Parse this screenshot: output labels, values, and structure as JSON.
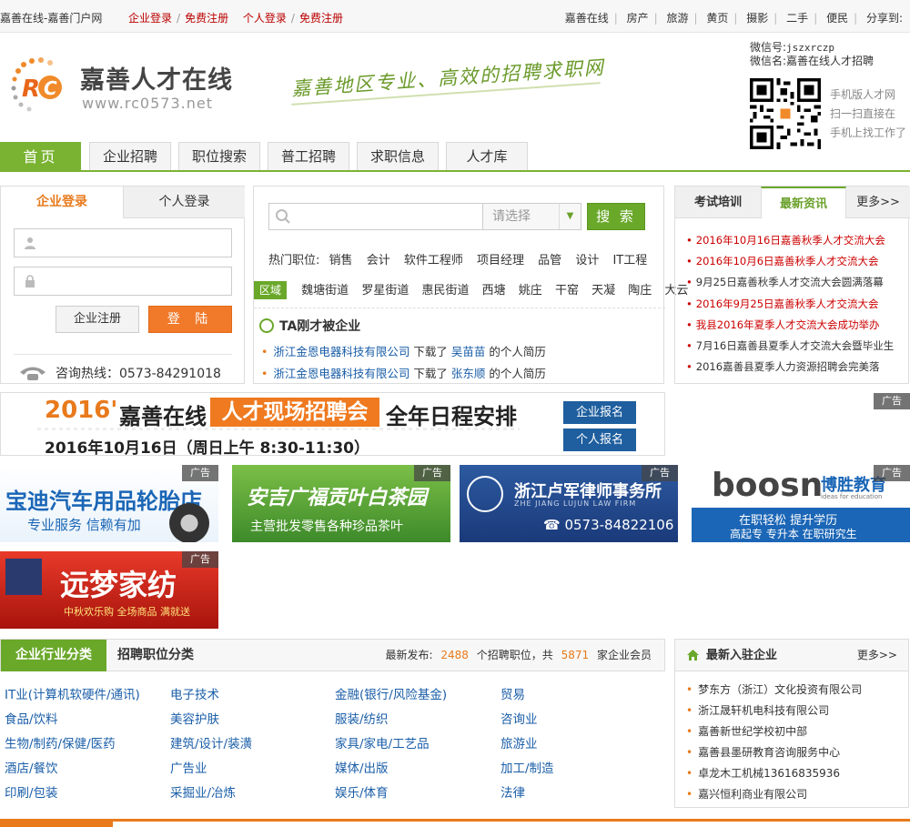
{
  "topbar": {
    "site_name": "嘉善在线-嘉善门户网",
    "company_login": "企业登录",
    "free_register": "免费注册",
    "personal_login": "个人登录",
    "free_register2": "免费注册",
    "nav": [
      "嘉善在线",
      "房产",
      "旅游",
      "黄页",
      "摄影",
      "二手",
      "便民"
    ],
    "share": "分享到:"
  },
  "header": {
    "logo_title": "嘉善人才在线",
    "logo_url": "www.rc0573.net",
    "slogan": "嘉善地区专业、高效的招聘求职网",
    "wechat_id_label": "微信号:",
    "wechat_id": "jszxrczp",
    "wechat_name": "微信名:嘉善在线人才招聘",
    "qr_text": [
      "手机版人才网",
      "扫一扫直接在",
      "手机上找工作了"
    ]
  },
  "mainnav": [
    "首页",
    "企业招聘",
    "职位搜索",
    "普工招聘",
    "求职信息",
    "人才库"
  ],
  "login": {
    "tab_company": "企业登录",
    "tab_personal": "个人登录",
    "username_placeholder": "",
    "password_placeholder": "",
    "register_btn": "企业注册",
    "login_btn": "登 陆",
    "hotline": "咨询热线：0573-84291018"
  },
  "search": {
    "placeholder": "",
    "select_label": "请选择",
    "button": "搜 索",
    "hot_label": "热门职位:",
    "hot_jobs": [
      "销售",
      "会计",
      "软件工程师",
      "项目经理",
      "品管",
      "设计",
      "IT工程"
    ],
    "area_label": "区域",
    "areas": [
      "魏塘街道",
      "罗星街道",
      "惠民街道",
      "西塘",
      "姚庄",
      "干窑",
      "天凝",
      "陶庄",
      "大云"
    ],
    "ta_title": "TA刚才被企业",
    "ta_items": [
      {
        "company": "浙江金恩电器科技有限公司",
        "action": "下载了",
        "name": "吴苗苗",
        "suffix": "的个人简历"
      },
      {
        "company": "浙江金恩电器科技有限公司",
        "action": "下载了",
        "name": "张东顺",
        "suffix": "的个人简历"
      }
    ]
  },
  "news": {
    "tab1": "考试培训",
    "tab2": "最新资讯",
    "more": "更多>>",
    "items": [
      {
        "text": "2016年10月16日嘉善秋季人才交流大会",
        "red": true
      },
      {
        "text": "2016年10月6日嘉善秋季人才交流大会",
        "red": true
      },
      {
        "text": "9月25日嘉善秋季人才交流大会圆满落幕",
        "red": false
      },
      {
        "text": "2016年9月25日嘉善秋季人才交流大会",
        "red": true
      },
      {
        "text": "我县2016年夏季人才交流大会成功举办",
        "red": true
      },
      {
        "text": "7月16日嘉善县夏季人才交流大会暨毕业生",
        "red": false
      },
      {
        "text": "2016嘉善县夏季人力资源招聘会完美落",
        "red": false
      }
    ]
  },
  "banner": {
    "year": "2016'",
    "title1": "嘉善在线",
    "highlight": "人才现场招聘会",
    "title2": "全年日程安排",
    "date": "2016年10月16日（周日上午 8:30-11:30）",
    "btn_company": "企业报名",
    "btn_personal": "个人报名",
    "ad_tag": "广告"
  },
  "ads": {
    "tag": "广告",
    "ad1": {
      "title": "宝迪汽车用品轮胎店",
      "sub": "专业服务 信赖有加"
    },
    "ad2": {
      "title": "安吉广福贡叶白茶园",
      "sub": "主营批发零售各种珍品茶叶"
    },
    "ad3": {
      "title": "浙江卢军律师事务所",
      "en": "ZHE JIANG LUJUN LAW FIRM",
      "phone": "☎ 0573-84822106"
    },
    "ad4": {
      "brand": "boosn",
      "cn": "博胜教育",
      "small": "ideas for education",
      "line1": "在职轻松  提升学历",
      "line2": "高起专  专升本  在职研究生"
    },
    "ad5": {
      "title": "远梦家纺",
      "sub": "中秋欢乐购 全场商品 满就送"
    }
  },
  "industry": {
    "tab1": "企业行业分类",
    "tab2": "招聘职位分类",
    "stat_prefix": "最新发布:",
    "jobs_count": "2488",
    "stat_mid": "个招聘职位，共",
    "company_count": "5871",
    "stat_suffix": "家企业会员",
    "items": [
      [
        "IT业(计算机软硬件/通讯)",
        "电子技术",
        "金融(银行/风险基金)",
        "贸易"
      ],
      [
        "食品/饮料",
        "美容护肤",
        "服装/纺织",
        "咨询业"
      ],
      [
        "生物/制药/保健/医药",
        "建筑/设计/装潢",
        "家具/家电/工艺品",
        "旅游业"
      ],
      [
        "酒店/餐饮",
        "广告业",
        "媒体/出版",
        "加工/制造"
      ],
      [
        "印刷/包装",
        "采掘业/冶炼",
        "娱乐/体育",
        "法律"
      ]
    ]
  },
  "newco": {
    "title": "最新入驻企业",
    "more": "更多>>",
    "items": [
      "梦东方（浙江）文化投资有限公司",
      "浙江晟轩机电科技有限公司",
      "嘉善新世纪学校初中部",
      "嘉善县墨研教育咨询服务中心",
      "卓龙木工机械13616835936",
      "嘉兴恒利商业有限公司"
    ]
  },
  "colors": {
    "green": "#7ab332",
    "orange": "#e87a1c",
    "blue": "#1a5ea8"
  }
}
